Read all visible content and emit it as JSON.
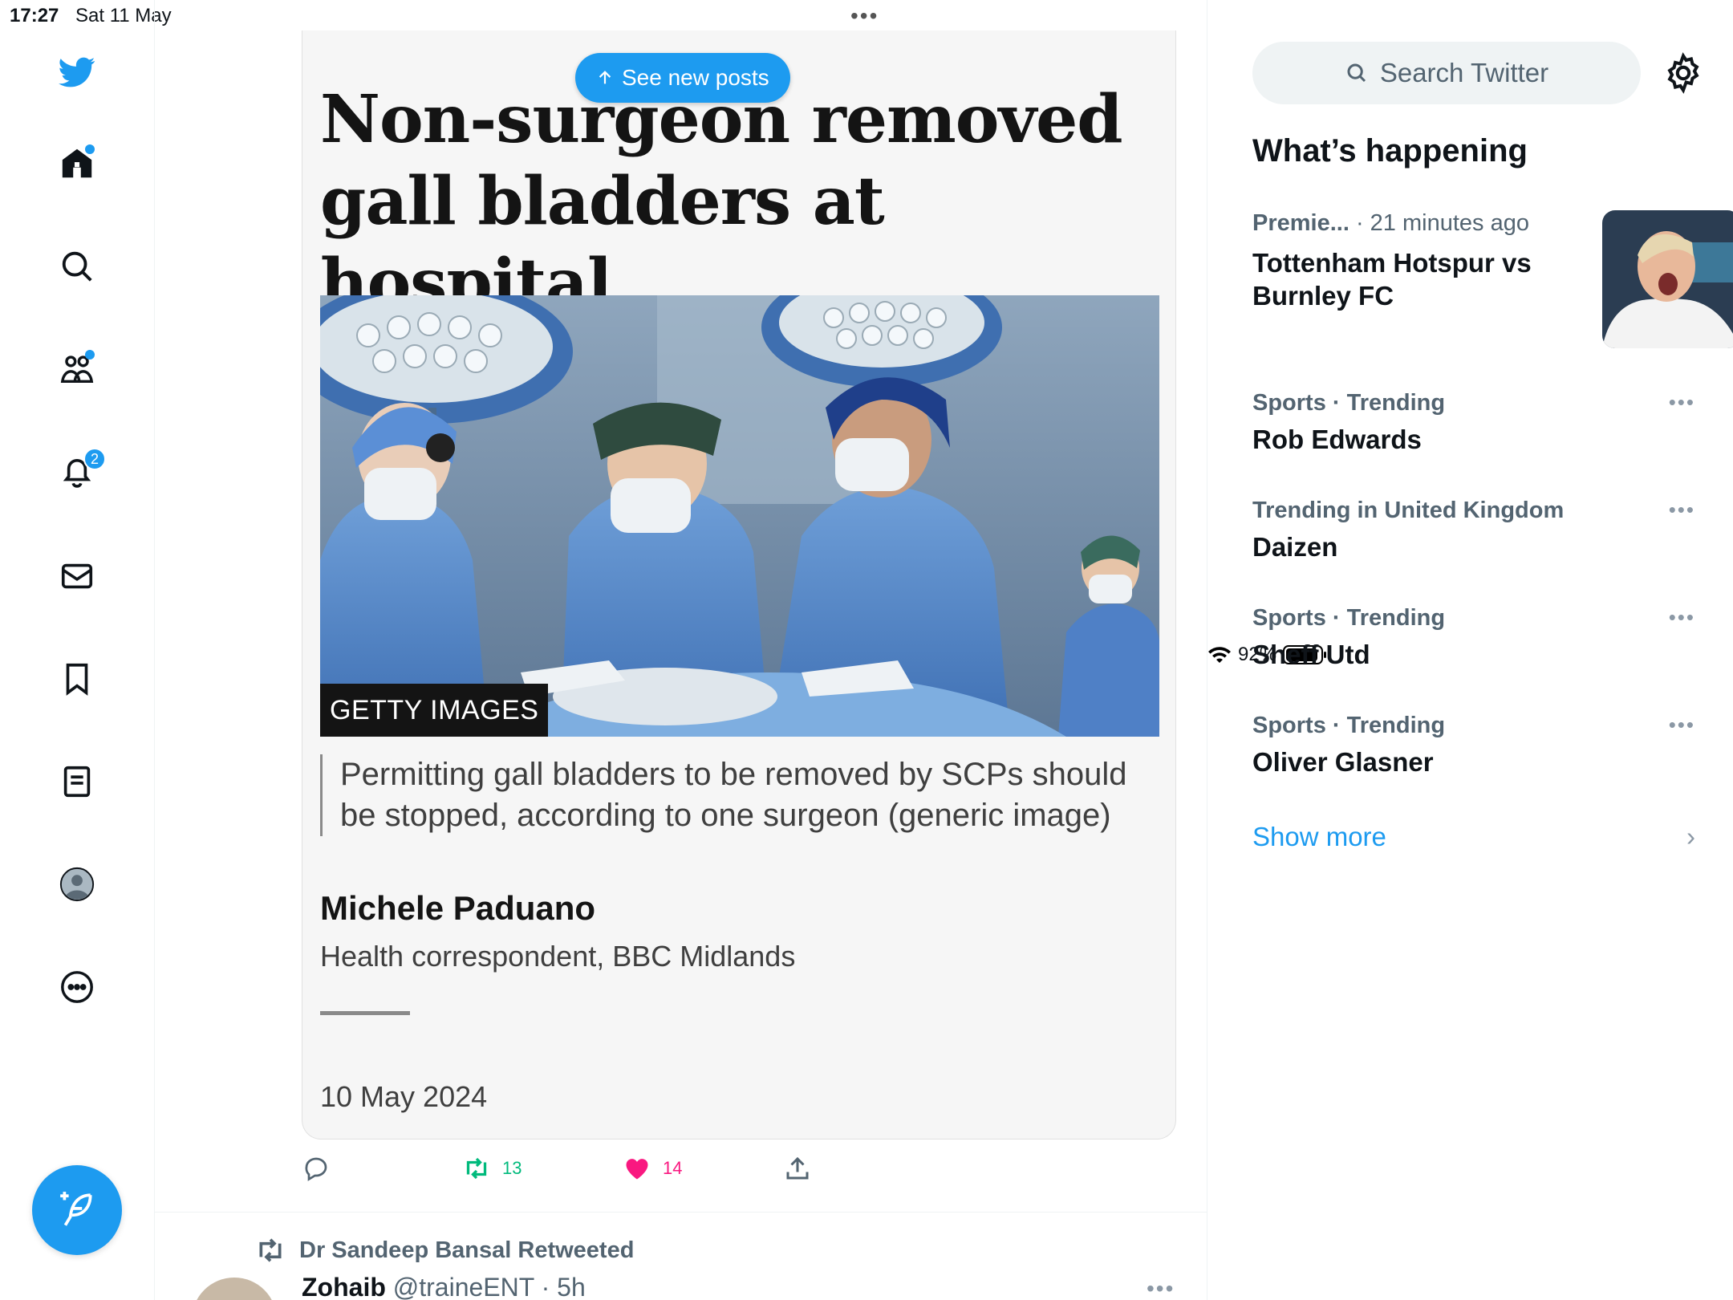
{
  "status_bar": {
    "time": "17:27",
    "date": "Sat 11 May",
    "battery_percent": "92%",
    "battery_level": 0.92
  },
  "nav": {
    "notifications_badge": "2",
    "items": [
      "twitter-logo",
      "home-icon",
      "search-icon",
      "communities-icon",
      "bell-icon",
      "mail-icon",
      "bookmark-icon",
      "lists-icon",
      "profile-avatar",
      "more-icon"
    ]
  },
  "feed": {
    "see_new_posts": "See new posts",
    "card": {
      "headline": "Non-surgeon removed gall bladders at hospital",
      "photo_credit": "GETTY IMAGES",
      "caption": "Permitting gall bladders to be removed by SCPs should be stopped, according to one surgeon (generic image)",
      "author": "Michele Paduano",
      "role": "Health correspondent, BBC Midlands",
      "date": "10 May 2024"
    },
    "actions": {
      "retweets": "13",
      "likes": "14"
    },
    "next_tweet": {
      "retweeted_by": "Dr Sandeep Bansal Retweeted",
      "name": "Zohaib",
      "handle": "@traineENT · 5h"
    }
  },
  "sidebar": {
    "search_placeholder": "Search Twitter",
    "section_title": "What’s happening",
    "news": {
      "category": "Premie...",
      "time": "· 21 minutes ago",
      "title": "Tottenham Hotspur vs Burnley FC"
    },
    "trends": [
      {
        "category": "Sports · Trending",
        "name": "Rob Edwards"
      },
      {
        "category": "Trending in United Kingdom",
        "name": "Daizen"
      },
      {
        "category": "Sports · Trending",
        "name": "Sheff Utd"
      },
      {
        "category": "Sports · Trending",
        "name": "Oliver Glasner"
      }
    ],
    "show_more": "Show more"
  },
  "colors": {
    "accent": "#1d9bf0",
    "retweet_green": "#00ba7c",
    "like_pink": "#f91880",
    "muted_text": "#536471"
  }
}
